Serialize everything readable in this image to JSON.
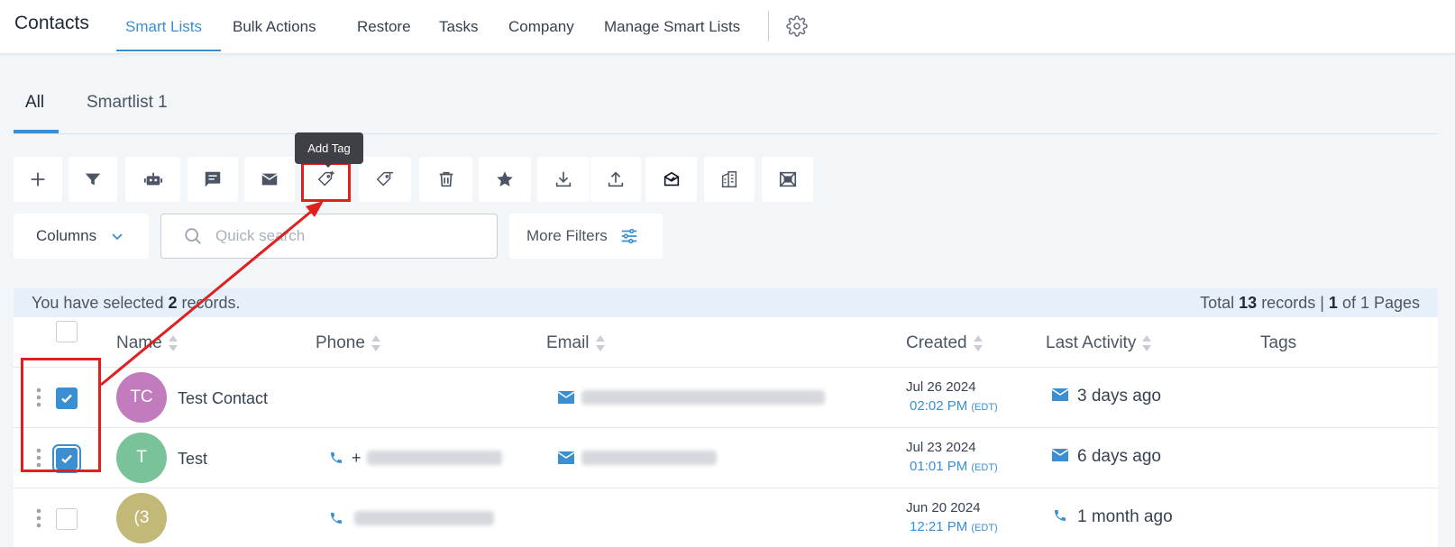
{
  "app_title": "Contacts",
  "nav": {
    "items": [
      "Smart Lists",
      "Bulk Actions",
      "Restore",
      "Tasks",
      "Company",
      "Manage Smart Lists"
    ],
    "active": "Smart Lists"
  },
  "subtabs": [
    "All",
    "Smartlist 1"
  ],
  "tooltip": "Add Tag",
  "toolbar": {
    "buttons": [
      "add-icon",
      "filter-icon",
      "robot-icon",
      "message-icon",
      "mail-icon",
      "add-tag-icon",
      "remove-tag-icon",
      "delete-icon",
      "star-icon",
      "download-icon",
      "upload-icon",
      "envelope-check-icon",
      "building-icon",
      "merge-icon"
    ]
  },
  "filters": {
    "columns_label": "Columns",
    "search_placeholder": "Quick search",
    "more_filters_label": "More Filters"
  },
  "selection": {
    "prefix": "You have selected",
    "count": "2",
    "suffix": "records.",
    "total_prefix": "Total",
    "total_count": "13",
    "total_mid": "records |",
    "page": "1",
    "page_suffix": "of 1 Pages"
  },
  "table": {
    "headers": {
      "name": "Name",
      "phone": "Phone",
      "email": "Email",
      "created": "Created",
      "last_activity": "Last Activity",
      "tags": "Tags"
    },
    "rows": [
      {
        "initials": "TC",
        "name": "Test Contact",
        "avatar_color": "#c27bbd",
        "created_date": "Jul 26 2024",
        "created_time": "02:02 PM",
        "tz": "(EDT)",
        "activity": "3 days ago",
        "checked": true
      },
      {
        "initials": "T",
        "name": "Test",
        "avatar_color": "#79c29a",
        "phone_prefix": "+",
        "created_date": "Jul 23 2024",
        "created_time": "01:01 PM",
        "tz": "(EDT)",
        "activity": "6 days ago",
        "checked": true
      },
      {
        "initials": "(3",
        "name": "",
        "avatar_color": "#c2b877",
        "created_date": "Jun 20 2024",
        "created_time": "12:21 PM",
        "tz": "(EDT)",
        "activity": "1 month ago",
        "checked": false
      }
    ]
  },
  "colors": {
    "accent": "#3b8fd1",
    "annotation": "#e01f1f"
  }
}
